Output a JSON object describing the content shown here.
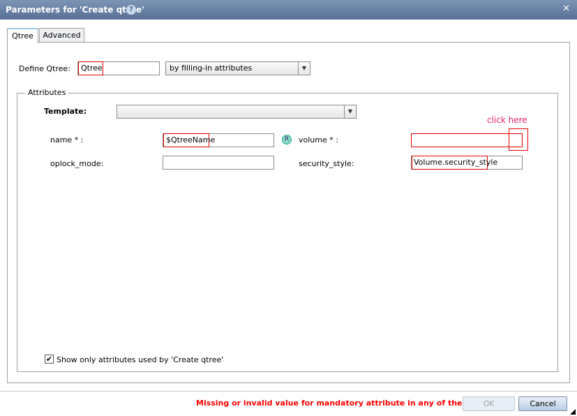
{
  "dialog": {
    "title": "Parameters for 'Create qtree'",
    "help_icon": "?",
    "close_icon": "✕"
  },
  "tabs": [
    {
      "label": "Qtree",
      "active": true
    },
    {
      "label": "Advanced",
      "active": false
    }
  ],
  "define": {
    "label": "Define Qtree:",
    "value": "Qtree",
    "mode": "by filling-in attributes"
  },
  "attributes": {
    "legend": "Attributes",
    "template_label": "Template:",
    "template_value": "",
    "name_label": "name * :",
    "name_value": "$QtreeName",
    "r_badge": "R",
    "volume_label": "volume * :",
    "volume_value": "",
    "oplock_label": "oplock_mode:",
    "oplock_value": "",
    "security_label": "security_style:",
    "security_value": "Volume.security_style",
    "annotation": "click here",
    "show_only_label": "Show only attributes used by 'Create qtree'",
    "show_only_checked": true
  },
  "footer": {
    "error": "Missing or invalid value for mandatory attribute in any of the tabs",
    "ok": "OK",
    "cancel": "Cancel"
  }
}
